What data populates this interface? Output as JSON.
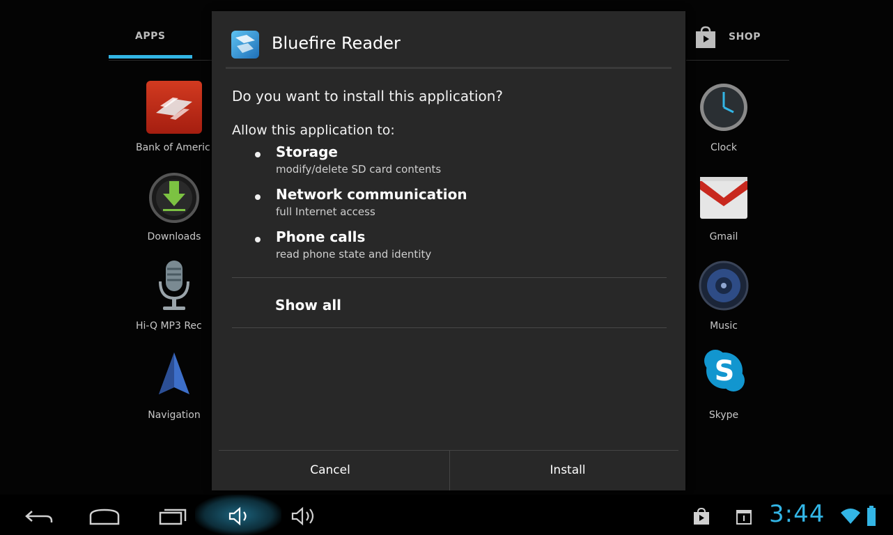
{
  "launcher": {
    "tabs": {
      "apps": "APPS",
      "shop": "SHOP"
    },
    "apps_left": [
      {
        "label": "Bank of Americ",
        "icon": "bank-of-america-icon"
      },
      {
        "label": "Downloads",
        "icon": "download-icon"
      },
      {
        "label": "Hi-Q MP3 Rec",
        "icon": "microphone-icon"
      },
      {
        "label": "Navigation",
        "icon": "navigation-arrow-icon"
      }
    ],
    "apps_right": [
      {
        "label": "Clock",
        "icon": "clock-icon"
      },
      {
        "label": "Gmail",
        "icon": "gmail-icon"
      },
      {
        "label": "Music",
        "icon": "speaker-icon"
      },
      {
        "label": "Skype",
        "icon": "skype-icon"
      }
    ]
  },
  "dialog": {
    "app_name": "Bluefire Reader",
    "question": "Do you want to install this application?",
    "allow_label": "Allow this application to:",
    "permissions": [
      {
        "title": "Storage",
        "desc": "modify/delete SD card contents"
      },
      {
        "title": "Network communication",
        "desc": "full Internet access"
      },
      {
        "title": "Phone calls",
        "desc": "read phone state and identity"
      }
    ],
    "show_all": "Show all",
    "cancel": "Cancel",
    "install": "Install"
  },
  "status": {
    "time": "3:44"
  },
  "colors": {
    "accent": "#33b5e5",
    "dialog_bg": "#282828"
  }
}
